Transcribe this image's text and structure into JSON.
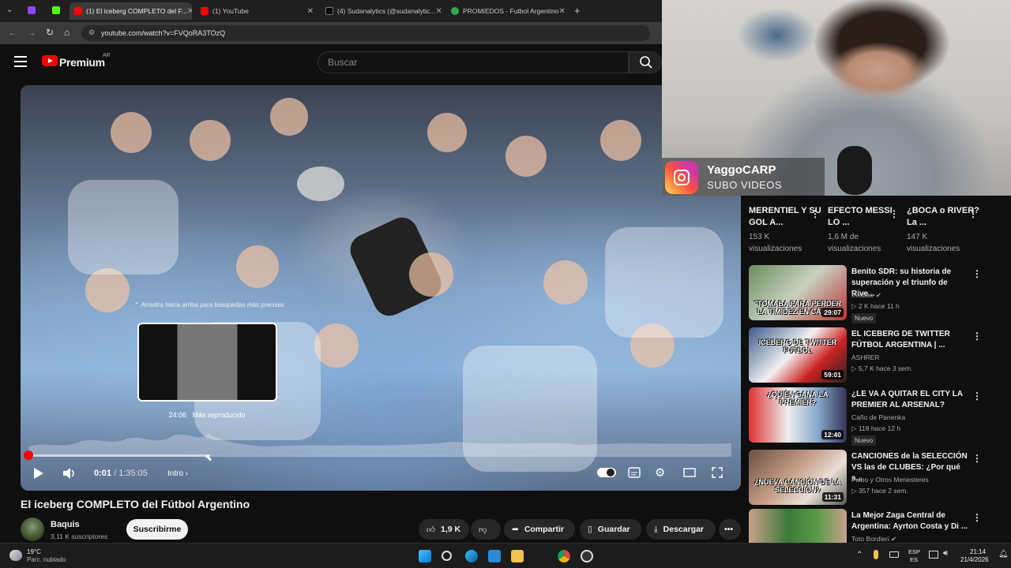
{
  "browser": {
    "tabs": [
      {
        "label": "(1) El iceberg COMPLETO del F...",
        "active": true
      },
      {
        "label": "(1) YouTube",
        "active": false
      },
      {
        "label": "(4) Sudanalytics (@sudanalytic...",
        "active": false
      },
      {
        "label": "PROMIEDOS - Futbol Argentino",
        "active": false
      }
    ],
    "new_tab": "+",
    "url": "youtube.com/watch?v=FVQoRA3TOzQ"
  },
  "header": {
    "brand": "Premium",
    "country": "AR",
    "search_placeholder": "Buscar"
  },
  "player": {
    "drag_hint": "Arrastra hacia arriba para búsquedas más precisas",
    "preview_time": "24:06",
    "preview_label": "Más reproducido",
    "current_time": "0:01",
    "total_time": "1:35:05",
    "separator": " / ",
    "chapter": "Intro",
    "progress_fraction": 0.0002
  },
  "video": {
    "title": "El iceberg COMPLETO del Fútbol Argentino",
    "channel": "Baquis",
    "subscribers": "3,11 K suscriptores",
    "subscribe_label": "Suscribirme",
    "likes": "1,9 K",
    "share_label": "Compartir",
    "save_label": "Guardar",
    "download_label": "Descargar"
  },
  "overlay": {
    "ig_user": "YaggoCARP",
    "ig_sub": "SUBO VIDEOS"
  },
  "shorts": [
    {
      "title": "MERENTIEL Y SU GOL A...",
      "views": "153 K visualizaciones"
    },
    {
      "title": "EFECTO MESSI LO ...",
      "views": "1,6 M de visualizaciones"
    },
    {
      "title": "¿BOCA o RIVER? La ...",
      "views": "147 K visualizaciones"
    }
  ],
  "recommendations": [
    {
      "title": "Benito SDR: su historia de superación y el triunfo de Rive...",
      "channel": "Infobae",
      "meta": "2 K   hace 11 h",
      "badge": "Nuevo",
      "duration": "29:07",
      "caption": "\"TOMABA PARA PERDER LA TIMIDEZ EN CÁMA..."
    },
    {
      "title": "EL ICEBERG DE TWITTER FÚTBOL ARGENTINA | ...",
      "channel": "ASHRER",
      "meta": "5,7 K   hace 3 sem.",
      "badge": "",
      "duration": "59:01",
      "caption": "ICEBERG DE TWITTER FÚTBOL"
    },
    {
      "title": "¿LE VA A QUITAR EL CITY LA PREMIER AL ARSENAL?",
      "channel": "Caño de Panenka",
      "meta": "118   hace 12 h",
      "badge": "Nuevo",
      "duration": "12:40",
      "caption": "¿QUIÉN GANA LA PREMIER?"
    },
    {
      "title": "CANCIONES de la SELECCIÓN VS las de CLUBES: ¿Por qué s...",
      "channel": "Fulbo y Otros Menesteres",
      "meta": "357   hace 2 sem.",
      "badge": "",
      "duration": "11:31",
      "caption": "¿NUEVA CANCIÓN DE LA SELECCIÓN?"
    },
    {
      "title": "La Mejor Zaga Central de Argentina: Ayrton Costa y Di ...",
      "channel": "Toto Bordieri",
      "meta": "",
      "badge": "",
      "duration": "",
      "caption": ""
    }
  ],
  "taskbar": {
    "temp": "19°C",
    "weather": "Parc. nublado",
    "lang1": "ESP",
    "lang2": "ES",
    "time": "21:14",
    "date": "21/4/2026"
  }
}
